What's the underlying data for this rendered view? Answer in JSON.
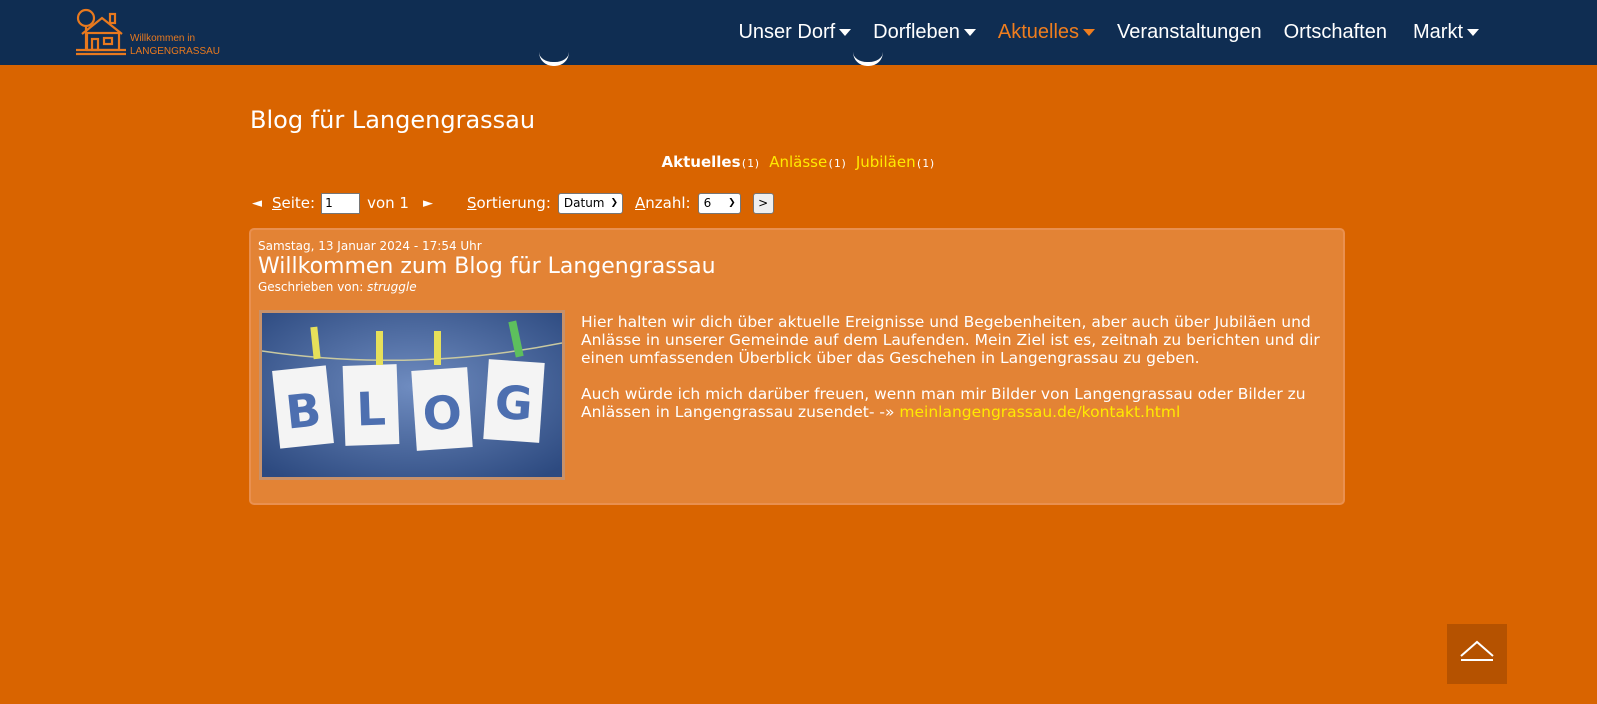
{
  "header": {
    "logo": {
      "line1": "Willkommen in",
      "line2": "LANGENGRASSAU"
    },
    "nav": [
      {
        "label": "Unser Dorf",
        "has_dropdown": true,
        "active": false
      },
      {
        "label": "Dorfleben",
        "has_dropdown": true,
        "active": false
      },
      {
        "label": "Aktuelles",
        "has_dropdown": true,
        "active": true
      },
      {
        "label": "Veranstaltungen",
        "has_dropdown": false,
        "active": false
      },
      {
        "label": "Ortschaften",
        "has_dropdown": false,
        "active": false
      },
      {
        "label": "Markt",
        "has_dropdown": true,
        "active": false
      }
    ]
  },
  "main": {
    "title": "Blog für Langengrassau",
    "categories": [
      {
        "name": "Aktuelles",
        "count": "(1)",
        "active": true
      },
      {
        "name": "Anlässe",
        "count": "(1)",
        "active": false
      },
      {
        "name": "Jubiläen",
        "count": "(1)",
        "active": false
      }
    ],
    "pager": {
      "page_label_first": "S",
      "page_label_rest": "eite:",
      "page_value": "1",
      "of_label": "von 1",
      "sort_label_first": "S",
      "sort_label_rest": "ortierung:",
      "sort_value": "Datum",
      "count_label_first": "A",
      "count_label_rest": "nzahl:",
      "count_value": "6",
      "go_label": ">"
    },
    "post": {
      "date": "Samstag, 13 Januar 2024 - 17:54 Uhr",
      "title": "Willkommen zum Blog für Langengrassau",
      "author_label": "Geschrieben von:",
      "author": "struggle",
      "image_letters": [
        "B",
        "L",
        "O",
        "G"
      ],
      "paragraph1": "Hier halten wir dich über aktuelle Ereignisse und Begebenheiten, aber auch über Jubiläen und Anlässe in unserer Gemeinde auf dem Laufenden. Mein Ziel ist es, zeitnah zu berichten und dir einen umfassenden Überblick über das Geschehen in Langengrassau zu geben.",
      "paragraph2": "Auch würde ich mich darüber freuen, wenn man mir Bilder von Langengrassau oder Bilder zu Anlässen in Langengrassau zusendet- -» ",
      "link": "meinlangengrassau.de/kontakt.html"
    }
  },
  "colors": {
    "background": "#d96400",
    "header": "#0f2d52",
    "accent": "#ef7d1e",
    "link": "#ffea00",
    "post_card": "#e38335",
    "scroll_top": "#b55200"
  },
  "icons": {
    "scroll_top": "chevron-up-icon",
    "prev": "triangle-left-icon",
    "next": "triangle-right-icon"
  }
}
